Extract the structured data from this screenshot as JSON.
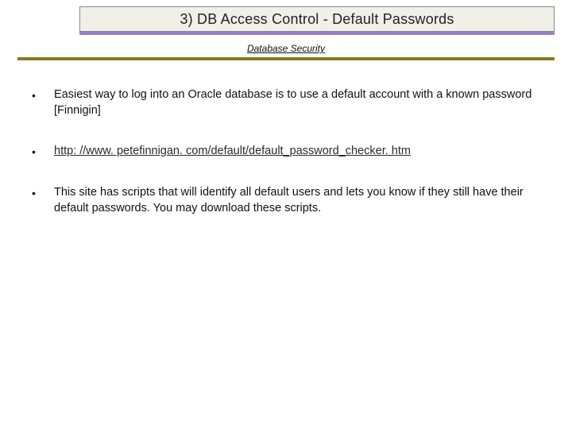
{
  "title": "3) DB Access Control - Default Passwords",
  "subtitle": "Database Security",
  "bullets": [
    {
      "text": "Easiest way to log into an Oracle database is to use a default account with a known password [Finnigin]",
      "is_link": false
    },
    {
      "text": "http: //www. petefinnigan. com/default/default_password_checker. htm",
      "is_link": true
    },
    {
      "text": "This site has scripts that will identify all default users and lets you know if they still have their default passwords. You may download these scripts.",
      "is_link": false
    }
  ]
}
